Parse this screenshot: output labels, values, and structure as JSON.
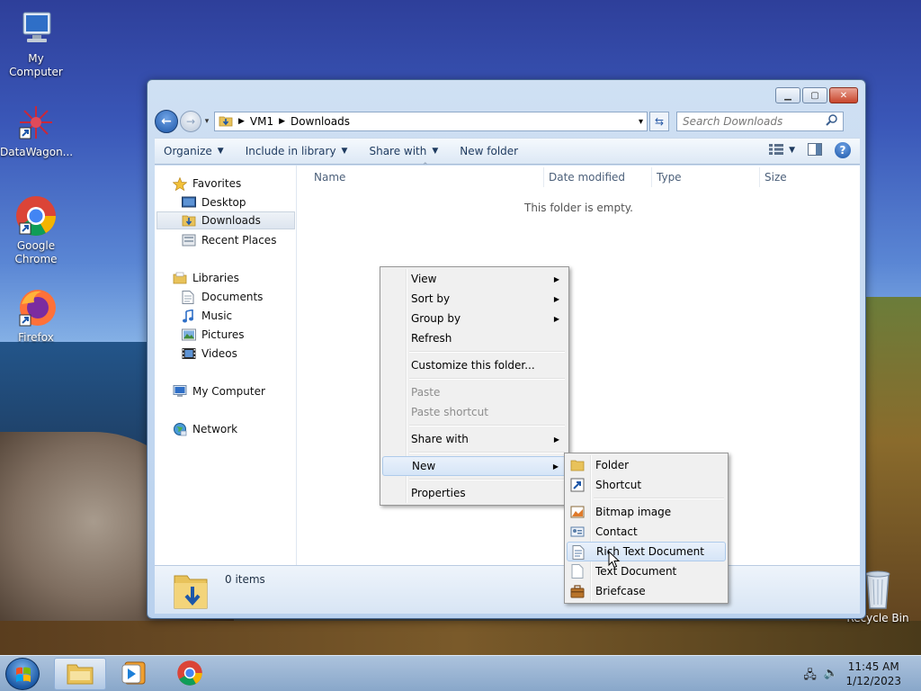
{
  "desktop": {
    "icons": [
      {
        "label": "My Computer"
      },
      {
        "label": "DataWagon..."
      },
      {
        "label": "Google Chrome"
      },
      {
        "label": "Firefox"
      },
      {
        "label": "Recycle Bin"
      }
    ]
  },
  "window": {
    "breadcrumb": [
      "VM1",
      "Downloads"
    ],
    "search_placeholder": "Search Downloads",
    "toolbar": {
      "organize": "Organize",
      "include_in_library": "Include in library",
      "share_with": "Share with",
      "new_folder": "New folder"
    },
    "nav": {
      "favorites": "Favorites",
      "desktop": "Desktop",
      "downloads": "Downloads",
      "recent_places": "Recent Places",
      "libraries": "Libraries",
      "documents": "Documents",
      "music": "Music",
      "pictures": "Pictures",
      "videos": "Videos",
      "my_computer": "My Computer",
      "network": "Network"
    },
    "columns": {
      "name": "Name",
      "date_modified": "Date modified",
      "type": "Type",
      "size": "Size"
    },
    "empty_message": "This folder is empty.",
    "item_count": "0 items"
  },
  "context_menu": {
    "view": "View",
    "sort_by": "Sort by",
    "group_by": "Group by",
    "refresh": "Refresh",
    "customize": "Customize this folder...",
    "paste": "Paste",
    "paste_shortcut": "Paste shortcut",
    "share_with": "Share with",
    "new": "New",
    "properties": "Properties"
  },
  "new_submenu": {
    "folder": "Folder",
    "shortcut": "Shortcut",
    "bitmap": "Bitmap image",
    "contact": "Contact",
    "rich_text": "Rich Text Document",
    "text": "Text Document",
    "briefcase": "Briefcase"
  },
  "taskbar": {
    "time": "11:45 AM",
    "date": "1/12/2023"
  },
  "colors": {
    "accent": "#1d57a8",
    "menu_highlight": "#d6e5f7"
  }
}
